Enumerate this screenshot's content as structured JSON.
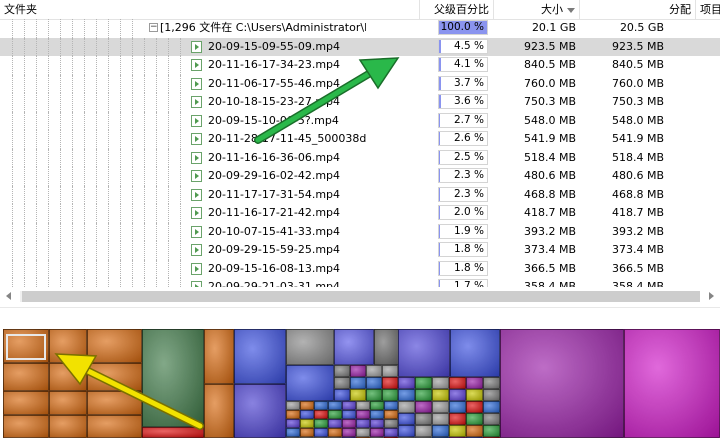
{
  "columns": {
    "folder": "文件夹",
    "parent_pct": "父级百分比",
    "size": "大小",
    "allocated": "分配",
    "items": "项目"
  },
  "folder_row": {
    "label": "[1,296 文件在 C:\\Users\\Administrator\\De",
    "percent_text": "100.0 %",
    "percent_value": 100.0,
    "size": "20.1 GB",
    "allocated": "20.5 GB"
  },
  "files": [
    {
      "name": "20-09-15-09-55-09.mp4",
      "percent_text": "4.5 %",
      "percent_value": 4.5,
      "size": "923.5 MB",
      "allocated": "923.5 MB",
      "selected": true
    },
    {
      "name": "20-11-16-17-34-23.mp4",
      "percent_text": "4.1 %",
      "percent_value": 4.1,
      "size": "840.5 MB",
      "allocated": "840.5 MB"
    },
    {
      "name": "20-11-06-17-55-46.mp4",
      "percent_text": "3.7 %",
      "percent_value": 3.7,
      "size": "760.0 MB",
      "allocated": "760.0 MB"
    },
    {
      "name": "20-10-18-15-23-27.mp4",
      "percent_text": "3.6 %",
      "percent_value": 3.6,
      "size": "750.3 MB",
      "allocated": "750.3 MB"
    },
    {
      "name": "20-09-15-10-00-5?.mp4",
      "percent_text": "2.7 %",
      "percent_value": 2.7,
      "size": "548.0 MB",
      "allocated": "548.0 MB"
    },
    {
      "name": "20-11-28-17-11-45_500038da53",
      "percent_text": "2.6 %",
      "percent_value": 2.6,
      "size": "541.9 MB",
      "allocated": "541.9 MB"
    },
    {
      "name": "20-11-16-16-36-06.mp4",
      "percent_text": "2.5 %",
      "percent_value": 2.5,
      "size": "518.4 MB",
      "allocated": "518.4 MB"
    },
    {
      "name": "20-09-29-16-02-42.mp4",
      "percent_text": "2.3 %",
      "percent_value": 2.3,
      "size": "480.6 MB",
      "allocated": "480.6 MB"
    },
    {
      "name": "20-11-17-17-31-54.mp4",
      "percent_text": "2.3 %",
      "percent_value": 2.3,
      "size": "468.8 MB",
      "allocated": "468.8 MB"
    },
    {
      "name": "20-11-16-17-21-42.mp4",
      "percent_text": "2.0 %",
      "percent_value": 2.0,
      "size": "418.7 MB",
      "allocated": "418.7 MB"
    },
    {
      "name": "20-10-07-15-41-33.mp4",
      "percent_text": "1.9 %",
      "percent_value": 1.9,
      "size": "393.2 MB",
      "allocated": "393.2 MB"
    },
    {
      "name": "20-09-29-15-59-25.mp4",
      "percent_text": "1.8 %",
      "percent_value": 1.8,
      "size": "373.4 MB",
      "allocated": "373.4 MB"
    },
    {
      "name": "20-09-15-16-08-13.mp4",
      "percent_text": "1.8 %",
      "percent_value": 1.8,
      "size": "366.5 MB",
      "allocated": "366.5 MB"
    },
    {
      "name": "20-09-29-21-03-31.mp4",
      "percent_text": "1.7 %",
      "percent_value": 1.7,
      "size": "358.4 MB",
      "allocated": "358.4 MB"
    }
  ],
  "colors": {
    "selected_row": "#d9d9d9",
    "percent_bar": "#8a94ef",
    "arrow_green": "#1fa53a",
    "arrow_yellow": "#f2e200",
    "treemap_orange": "#d86a10",
    "treemap_blue": "#3a4fe0",
    "treemap_purple": "#9a1ea8",
    "treemap_magenta": "#d018c8"
  },
  "icons": {
    "file": "video-file-icon",
    "collapse": "minus-box-icon",
    "sort": "sort-descending-icon"
  }
}
